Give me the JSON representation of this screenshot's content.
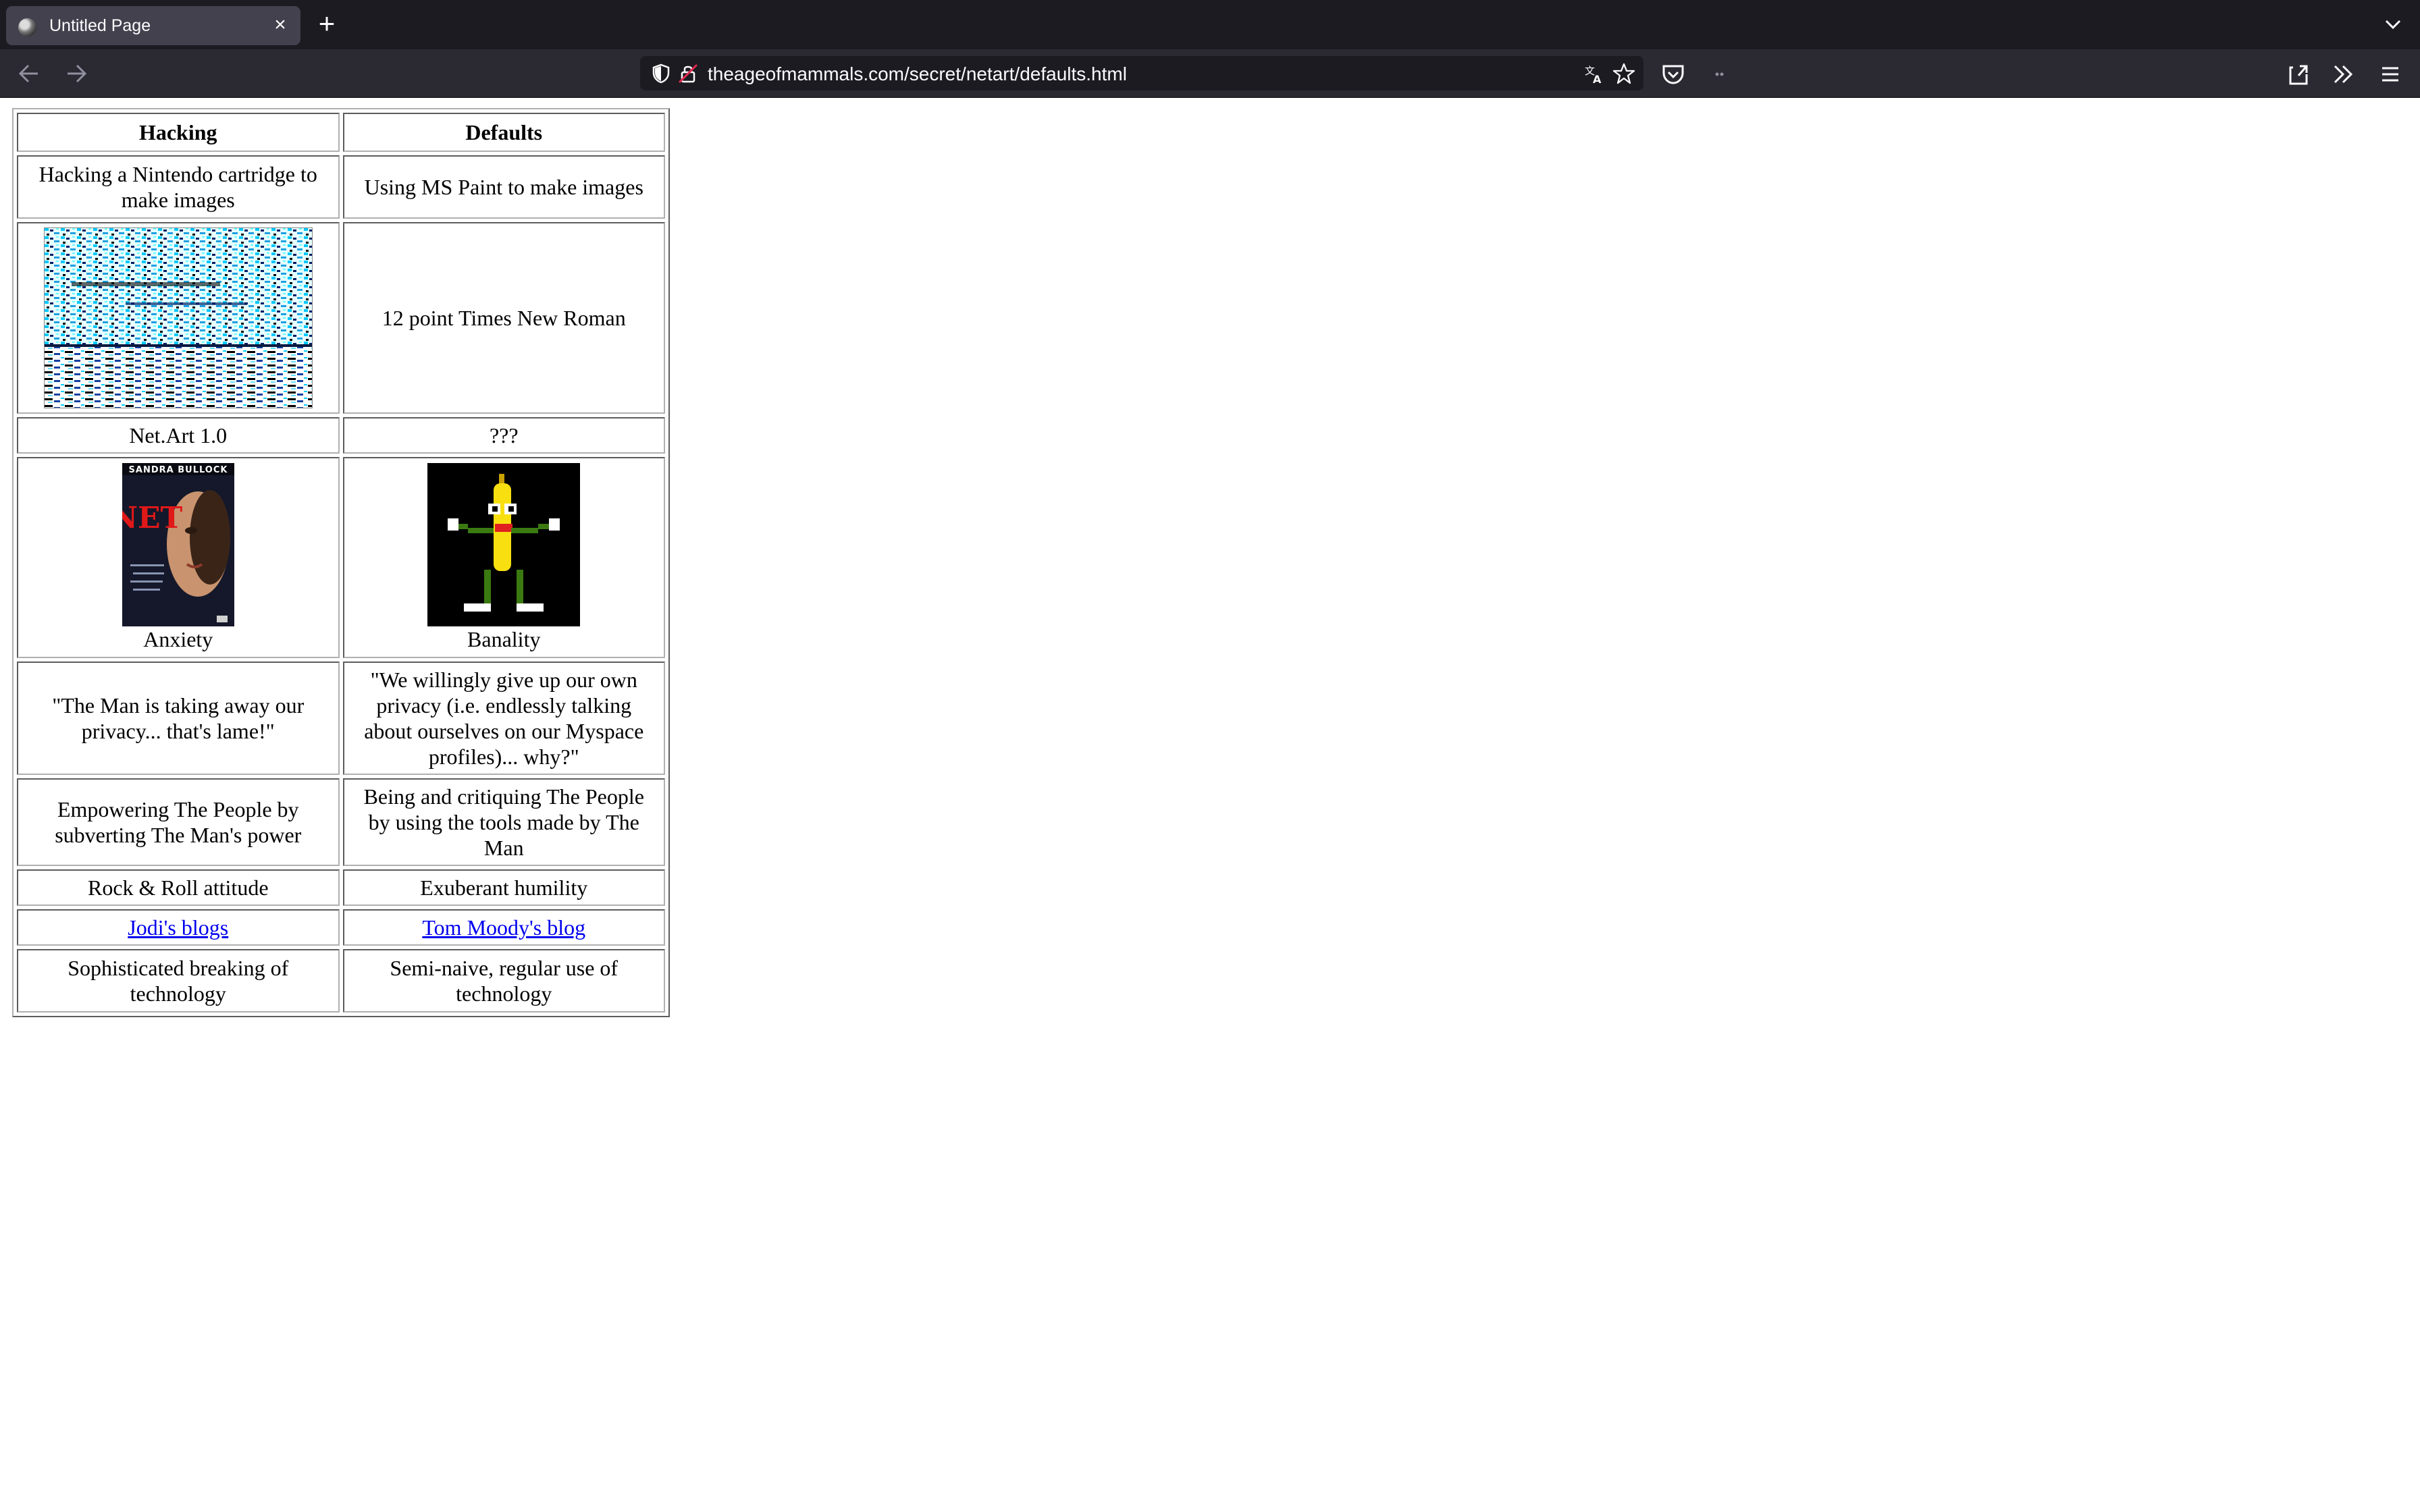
{
  "browser": {
    "tab_title": "Untitled Page",
    "url": "theageofmammals.com/secret/netart/defaults.html"
  },
  "table": {
    "headers": [
      "Hacking",
      "Defaults"
    ],
    "rows": {
      "r1": [
        "Hacking a Nintendo cartridge to make images",
        "Using MS Paint to make images"
      ],
      "r2_right": "12 point Times New Roman",
      "r3": [
        "Net.Art 1.0",
        "???"
      ],
      "r4_captions": [
        "Anxiety",
        "Banality"
      ],
      "r5": [
        "\"The Man is taking away our privacy... that's lame!\"",
        "\"We willingly give up our own privacy (i.e. endlessly talking about ourselves on our Myspace profiles)... why?\""
      ],
      "r6": [
        "Empowering The People by subverting The Man's power",
        "Being and critiquing The People by using the tools made by The Man"
      ],
      "r7": [
        "Rock & Roll attitude",
        "Exuberant humility"
      ],
      "r8_links": [
        "Jodi's blogs",
        "Tom Moody's blog"
      ],
      "r9": [
        "Sophisticated breaking of technology",
        "Semi-naive, regular use of technology"
      ]
    },
    "poster_text": {
      "actor": "SANDRA BULLOCK",
      "title": "NET"
    }
  },
  "colors": {
    "link": "#0000ee",
    "tabbar_bg": "#1c1b22",
    "navbar_bg": "#2b2a33",
    "tab_bg": "#42414d"
  }
}
